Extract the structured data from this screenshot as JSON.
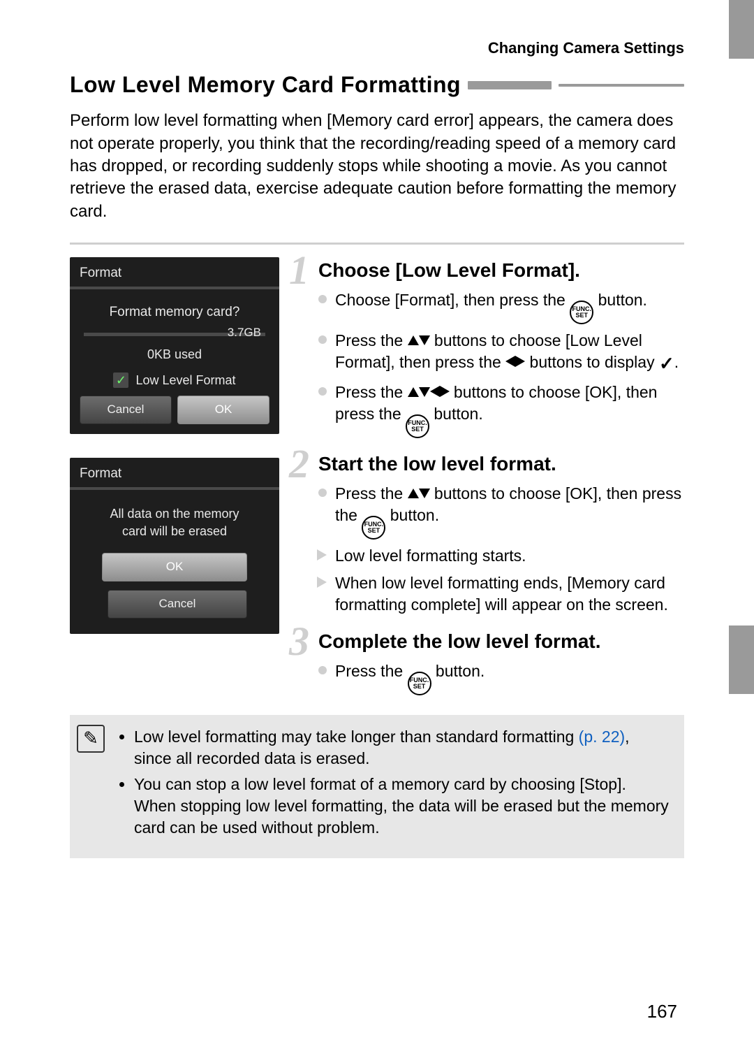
{
  "header": {
    "chapter": "Changing Camera Settings"
  },
  "title": "Low Level Memory Card Formatting",
  "intro": "Perform low level formatting when [Memory card error] appears, the camera does not operate properly, you think that the recording/reading speed of a memory card has dropped, or recording suddenly stops while shooting a movie. As you cannot retrieve the erased data, exercise adequate caution before formatting the memory card.",
  "screen1": {
    "title": "Format",
    "question": "Format memory card?",
    "size": "3.7GB",
    "used": "0KB used",
    "option": "Low Level Format",
    "cancel": "Cancel",
    "ok": "OK"
  },
  "screen2": {
    "title": "Format",
    "msg1": "All data on the memory",
    "msg2": "card will be erased",
    "ok": "OK",
    "cancel": "Cancel"
  },
  "steps": [
    {
      "num": "1",
      "heading": "Choose [Low Level Format].",
      "items": [
        {
          "t": "dot",
          "pre": "Choose [Format], then press the ",
          "post": " button.",
          "func": true
        },
        {
          "t": "dot",
          "pre": "Press the ",
          "mid": " buttons to choose [Low Level Format], then press the ",
          "post": " buttons to display ",
          "ud": true,
          "lr": true,
          "check": true
        },
        {
          "t": "dot",
          "pre": "Press the ",
          "mid": " buttons to choose [OK], then press the ",
          "post": " button.",
          "udlr": true,
          "func": true
        }
      ]
    },
    {
      "num": "2",
      "heading": "Start the low level format.",
      "items": [
        {
          "t": "dot",
          "pre": "Press the ",
          "mid": " buttons to choose [OK], then press the ",
          "post": " button.",
          "ud": true,
          "func": true
        },
        {
          "t": "arrow",
          "plain": "Low level formatting starts."
        },
        {
          "t": "arrow",
          "plain": "When low level formatting ends, [Memory card formatting complete] will appear on the screen."
        }
      ]
    },
    {
      "num": "3",
      "heading": "Complete the low level format.",
      "items": [
        {
          "t": "dot",
          "pre": "Press the ",
          "post": " button.",
          "func": true
        }
      ]
    }
  ],
  "notes": {
    "line1a": "Low level formatting may take longer than standard formatting ",
    "link": "(p. 22)",
    "line1b": ", since all recorded data is erased.",
    "line2": "You can stop a low level format of a memory card by choosing [Stop]. When stopping low level formatting, the data will be erased but the memory card can be used without problem."
  },
  "func": {
    "top": "FUNC.",
    "bot": "SET"
  },
  "pagenum": "167"
}
